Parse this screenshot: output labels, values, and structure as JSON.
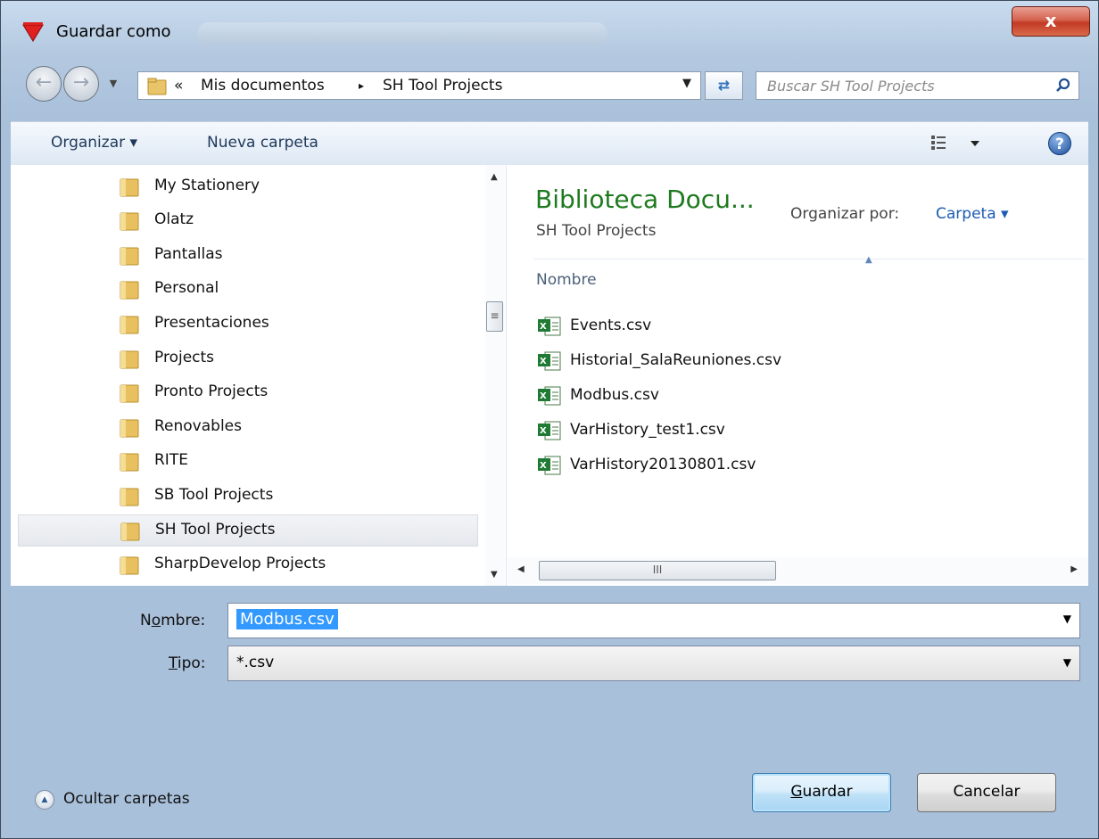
{
  "window": {
    "title": "Guardar como",
    "close_label": "x"
  },
  "address": {
    "prefix": "«",
    "crumbs": [
      "Mis documentos",
      "SH Tool Projects"
    ],
    "separator": "▸"
  },
  "search": {
    "placeholder": "Buscar SH Tool Projects"
  },
  "toolbar": {
    "organize_label": "Organizar ▾",
    "new_folder_label": "Nueva carpeta",
    "help_label": "?"
  },
  "tree": {
    "items": [
      "My Stationery",
      "Olatz",
      "Pantallas",
      "Personal",
      "Presentaciones",
      "Projects",
      "Pronto Projects",
      "Renovables",
      "RITE",
      "SB Tool Projects",
      "SH Tool Projects",
      "SharpDevelop Projects"
    ],
    "selected": "SH Tool Projects"
  },
  "library": {
    "title": "Biblioteca Docu...",
    "subtitle": "SH Tool Projects",
    "arrange_label": "Organizar por:",
    "arrange_value": "Carpeta ▾",
    "column_header": "Nombre"
  },
  "files": [
    "Events.csv",
    "Historial_SalaReuniones.csv",
    "Modbus.csv",
    "VarHistory_test1.csv",
    "VarHistory20130801.csv"
  ],
  "form": {
    "name_label_pre": "N",
    "name_label_u": "o",
    "name_label_post": "mbre:",
    "name_value": "Modbus.csv",
    "type_label_u": "T",
    "type_label_post": "ipo:",
    "type_value": "*.csv"
  },
  "footer": {
    "hide_folders_label": "Ocultar carpetas",
    "save_label_u": "G",
    "save_label_post": "uardar",
    "cancel_label": "Cancelar"
  },
  "colors": {
    "library_title": "#1e7a1e",
    "link": "#1c5bb5",
    "selection": "#3399ff"
  }
}
